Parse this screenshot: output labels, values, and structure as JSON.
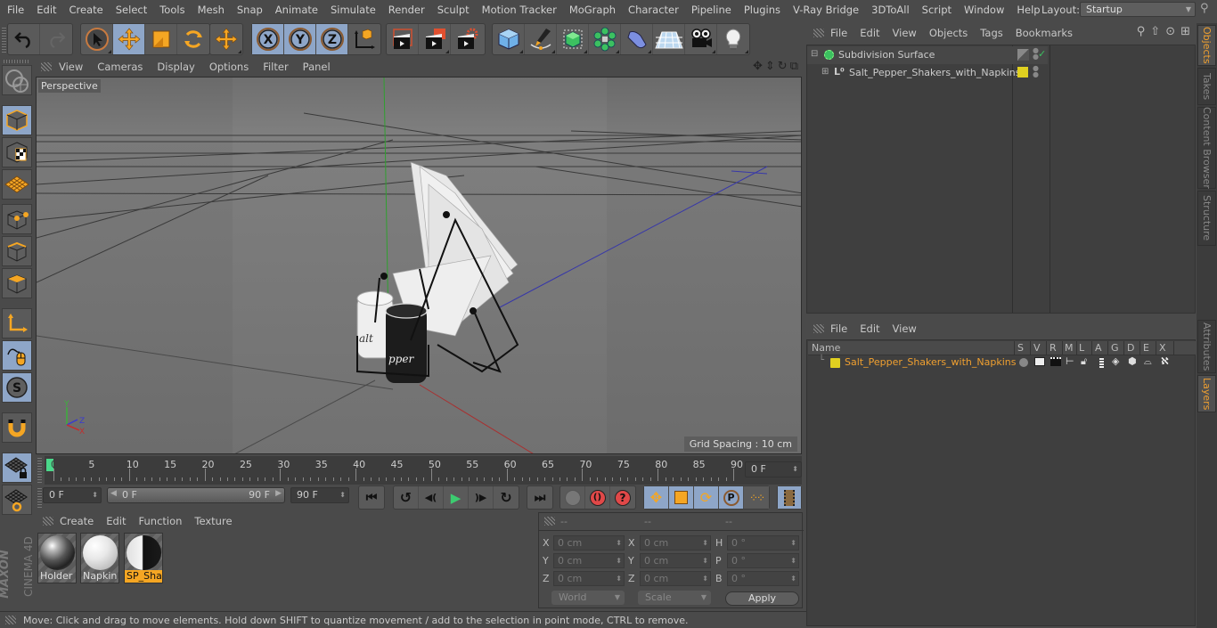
{
  "menubar": {
    "items": [
      "File",
      "Edit",
      "Create",
      "Select",
      "Tools",
      "Mesh",
      "Snap",
      "Animate",
      "Simulate",
      "Render",
      "Sculpt",
      "Motion Tracker",
      "MoGraph",
      "Character",
      "Pipeline",
      "Plugins",
      "V-Ray Bridge",
      "3DToAll",
      "Script",
      "Window",
      "Help"
    ],
    "layout_label": "Layout:",
    "layout_value": "Startup"
  },
  "toolbar": {
    "groups": [
      [
        "undo-icon",
        "redo-icon"
      ],
      [
        "live-selection-icon",
        "move-icon",
        "scale-icon",
        "rotate-icon"
      ],
      [
        "recent-tool-move-icon"
      ],
      [
        "x-axis-lock-icon",
        "y-axis-lock-icon",
        "z-axis-lock-icon",
        "coordinate-system-icon"
      ],
      [
        "render-view-icon",
        "render-picture-viewer-icon",
        "render-settings-icon"
      ],
      [
        "cube-icon",
        "spline-pen-icon",
        "subdivision-surface-icon",
        "cloner-icon",
        "deformer-icon",
        "floor-icon",
        "camera-icon",
        "light-icon"
      ]
    ]
  },
  "lefttools": [
    "make-editable-icon",
    "model-mode-icon",
    "texture-mode-icon",
    "workplane-icon",
    "points-mode-icon",
    "edges-mode-icon",
    "polygons-mode-icon",
    "axis-mode-icon",
    "tweak-mode-icon",
    "solo-mode-icon",
    "snap-icon",
    "locked-workplane-icon",
    "planar-workplane-icon"
  ],
  "viewport": {
    "menu": [
      "View",
      "Cameras",
      "Display",
      "Options",
      "Filter",
      "Panel"
    ],
    "camera_label": "Perspective",
    "grid_spacing": "Grid Spacing : 10 cm",
    "axis_labels": {
      "y": "Y",
      "z": "Z",
      "x": "X"
    }
  },
  "timeline": {
    "ticks": [
      "0",
      "5",
      "10",
      "15",
      "20",
      "25",
      "30",
      "35",
      "40",
      "45",
      "50",
      "55",
      "60",
      "65",
      "70",
      "75",
      "80",
      "85",
      "90"
    ],
    "current_frame_field": "0 F",
    "start_field": "0 F",
    "range_start": "0 F",
    "range_end": "90 F",
    "end_field": "90 F"
  },
  "material_manager": {
    "menu": [
      "Create",
      "Edit",
      "Function",
      "Texture"
    ],
    "materials": [
      {
        "name": "Holder",
        "selected": false
      },
      {
        "name": "Napkin",
        "selected": false
      },
      {
        "name": "SP_Shak",
        "selected": true
      }
    ]
  },
  "coordinates": {
    "headers": [
      "--",
      "--",
      "--"
    ],
    "position": [
      {
        "axis": "X",
        "value": "0 cm"
      },
      {
        "axis": "Y",
        "value": "0 cm"
      },
      {
        "axis": "Z",
        "value": "0 cm"
      }
    ],
    "size": [
      {
        "axis": "X",
        "value": "0 cm"
      },
      {
        "axis": "Y",
        "value": "0 cm"
      },
      {
        "axis": "Z",
        "value": "0 cm"
      }
    ],
    "rotation": [
      {
        "axis": "H",
        "value": "0 °"
      },
      {
        "axis": "P",
        "value": "0 °"
      },
      {
        "axis": "B",
        "value": "0 °"
      }
    ],
    "coord_mode": "World",
    "size_mode": "Scale",
    "apply_label": "Apply"
  },
  "status": {
    "text": "Move: Click and drag to move elements. Hold down SHIFT to quantize movement / add to the selection in point mode, CTRL to remove."
  },
  "objects_panel": {
    "menu": [
      "File",
      "Edit",
      "View",
      "Objects",
      "Tags",
      "Bookmarks"
    ],
    "objects": [
      {
        "name": "Subdivision Surface",
        "icon": "subdivision-surface-icon"
      },
      {
        "name": "Salt_Pepper_Shakers_with_Napkins",
        "icon": "null-object-icon"
      }
    ]
  },
  "layers_panel": {
    "menu": [
      "File",
      "Edit",
      "View"
    ],
    "columns": [
      "Name",
      "S",
      "V",
      "R",
      "M",
      "L",
      "A",
      "G",
      "D",
      "E",
      "X"
    ],
    "layers": [
      {
        "name": "Salt_Pepper_Shakers_with_Napkins",
        "color": "#e0d020"
      }
    ]
  },
  "side_tabs": {
    "top": [
      {
        "label": "Objects",
        "active": true
      },
      {
        "label": "Takes",
        "active": false
      },
      {
        "label": "Content Browser",
        "active": false
      },
      {
        "label": "Structure",
        "active": false
      }
    ],
    "bottom": [
      {
        "label": "Attributes",
        "active": false
      },
      {
        "label": "Layers",
        "active": true
      }
    ]
  },
  "brand": {
    "maxon": "MAXON",
    "product": "CINEMA 4D"
  },
  "colors": {
    "accent": "#f0a030",
    "active_button": "#8ea6c8",
    "selection": "#f5a623"
  }
}
